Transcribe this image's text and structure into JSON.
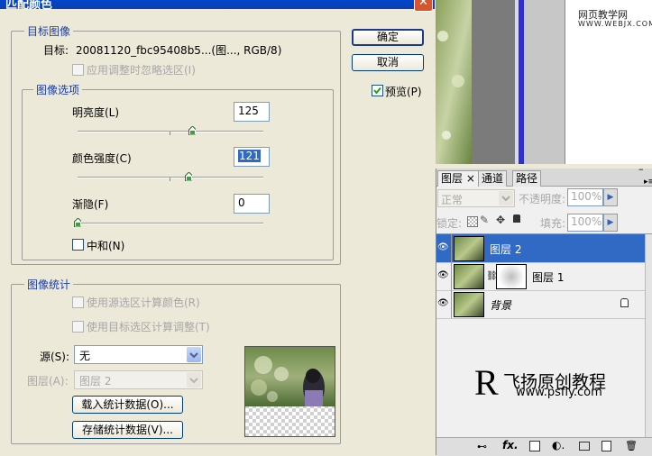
{
  "dialog": {
    "title": "匹配颜色",
    "target_group": {
      "legend": "目标图像",
      "target_label": "目标:",
      "target_value": "20081120_fbc95408b5...(图..., RGB/8)",
      "ignore_selection_label": "应用调整时忽略选区(I)"
    },
    "image_options": {
      "legend": "图像选项",
      "luminance_label": "明亮度(L)",
      "luminance_value": "125",
      "luminance_level": 0.5,
      "color_intensity_label": "颜色强度(C)",
      "color_intensity_value": "121",
      "color_intensity_level": 0.6,
      "fade_label": "渐隐(F)",
      "fade_value": "0",
      "fade_level": 0,
      "neutralize_label": "中和(N)"
    },
    "image_stats": {
      "legend": "图像统计",
      "use_source_selection_label": "使用源选区计算颜色(R)",
      "use_target_selection_label": "使用目标选区计算调整(T)",
      "source_label": "源(S):",
      "source_value": "无",
      "layer_label": "图层(A):",
      "layer_value": "图层 2",
      "load_stats_label": "载入统计数据(O)...",
      "save_stats_label": "存储统计数据(V)..."
    },
    "ok_label": "确定",
    "cancel_label": "取消",
    "preview_label": "预览(P)",
    "preview_checked": true
  },
  "watermark": {
    "site_cn": "网页教学网",
    "site_url": "WWW.WEBJX.COM"
  },
  "layers": {
    "tabs": [
      "图层",
      "通道",
      "路径"
    ],
    "blend_mode": "正常",
    "opacity_label": "不透明度:",
    "opacity_value": "100%",
    "lock_label": "锁定:",
    "fill_label": "填充:",
    "fill_value": "100%",
    "items": [
      {
        "name": "图层 2",
        "selected": true
      },
      {
        "name": "图层 1",
        "selected": false
      },
      {
        "name": "背景",
        "selected": false
      }
    ]
  },
  "brand": {
    "letter": "R",
    "name": "飞扬原创教程",
    "url": "www.psfly.com"
  },
  "colors": {
    "title_bar": "#0a5ee8",
    "selection": "#316ac5",
    "legend_text": "#1b3ca2"
  }
}
